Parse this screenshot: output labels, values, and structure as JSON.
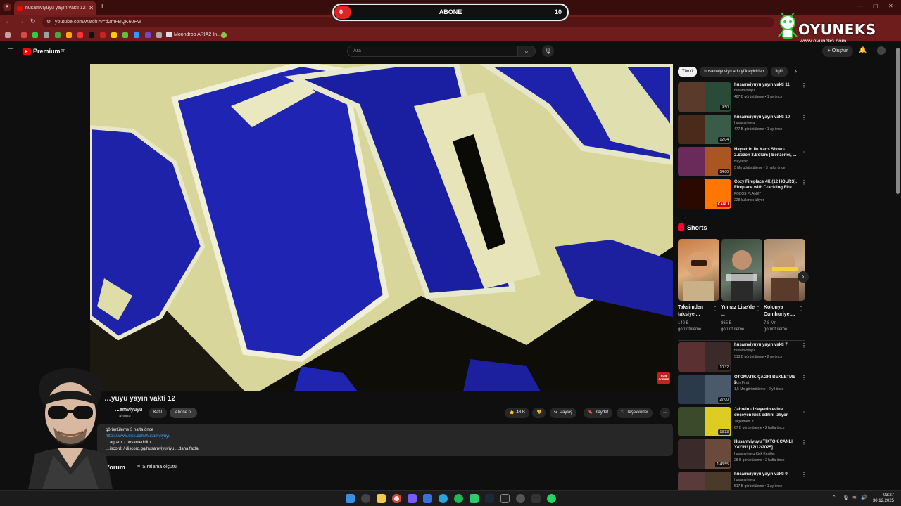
{
  "browser": {
    "tab_title": "husamviyuyu yayın vakti 12 - You",
    "tab_close": "✕",
    "new_tab": "+",
    "url": "youtube.com/watch?v=d2mFBQK60Hw",
    "bookmark_label": "Moondrop ARIA2 In..."
  },
  "overlay": {
    "sub_current": "0",
    "sub_label": "ABONE",
    "sub_goal": "10",
    "sub_progress": 0.0,
    "logo_brand": "OYUNEKS",
    "logo_url": "www.oyuneks.com"
  },
  "youtube": {
    "logo_text": "Premium",
    "logo_sup": "TR",
    "search_placeholder": "Ara",
    "create_label": "Oluştur"
  },
  "video": {
    "title": "…yuyu yayın vakti 12",
    "channel": "…amviyuyu",
    "subs": "…abone",
    "join_label": "Katıl",
    "subscribe_label": "Abone ol",
    "likes": "43 B",
    "share_label": "Paylaş",
    "save_label": "Kaydet",
    "thanks_label": "Teşekkürler",
    "more_label": "···",
    "badge_text": "SUB SCRIBE",
    "desc_line1": "görüntüleme  3 hafta önce",
    "desc_line2": "https://www.kick.com/husamviyuyu",
    "desc_line3": "…agram:   / husamedditnl",
    "desc_line4": "…iscord:   / discord.gg/husamviyuviyu   ...daha fazla",
    "comments_label": "Yorum",
    "sort_label": "Sıralama ölçütü:"
  },
  "chips": [
    "Tümü",
    "husamviyuviyu adlı yükleyiciden",
    "İlgili"
  ],
  "recommendations": [
    {
      "title": "husamviyuyu yayın vakti 11",
      "channel": "husamviyuyu",
      "meta": "487 B görüntüleme • 1 ay önce",
      "duration": "9:50",
      "colors": [
        "#5a3a2a",
        "#2a4a3a"
      ]
    },
    {
      "title": "husamviyuyu yayın vakti 10",
      "channel": "husamviyuyu",
      "meta": "477 B görüntüleme • 1 ay önce",
      "duration": "12:04",
      "colors": [
        "#4a2a1a",
        "#3a5a4a"
      ]
    },
    {
      "title": "Hayrettin ile Kaos Show - 2.Sezon 3.Bölüm | Benzerler, ...",
      "channel": "Hayrettin",
      "meta": "5 Mn görüntüleme • 3 hafta önce",
      "duration": "54:00",
      "colors": [
        "#6a2a5a",
        "#aa5522"
      ]
    },
    {
      "title": "Cozy Fireplace 4K (12 HOURS). Fireplace with Crackling Fire ...",
      "channel": "FOBOS PLANET",
      "meta": "228 kullanıcı izliyor",
      "duration": "CANLI",
      "colors": [
        "#2a0a00",
        "#ff7700"
      ]
    }
  ],
  "shorts": {
    "heading": "Shorts",
    "items": [
      {
        "title": "Taksimden taksiye ...",
        "views": "140 B görüntüleme"
      },
      {
        "title": "Yılmaz Lise'de ...",
        "views": "865 B görüntüleme"
      },
      {
        "title": "Kolonya Cumhuriyet...",
        "views": "7,8 Mn görüntüleme"
      }
    ]
  },
  "recommendations2": [
    {
      "title": "husamviyuyu yayın vakti 7",
      "channel": "husamviyuyu",
      "meta": "513 B görüntüleme • 2 ay önce",
      "duration": "10:32",
      "colors": [
        "#5a3030",
        "#3a2a2a"
      ]
    },
    {
      "title": "OTOMATİK ÇAĞRI BEKLETME 2",
      "channel": "İlker Fırat",
      "meta": "1,5 Mn görüntüleme • 2 yıl önce",
      "duration": "27:00",
      "colors": [
        "#2a3a4a",
        "#4a5a6a"
      ]
    },
    {
      "title": "Jahrein - İzleyenin evine döşeyen kick editini izliyor",
      "channel": "Jagermeh Jr.",
      "meta": "67 B görüntüleme • 2 hafta önce",
      "duration": "13:33",
      "colors": [
        "#3a4a2a",
        "#ddcc22"
      ]
    },
    {
      "title": "Husamviyuyu TİKTOK CANLI YAYIN! [12/12/2025]",
      "channel": "husamviyuyu Kick Kesitler",
      "meta": "28 B görüntüleme • 2 hafta önce",
      "duration": "1:43:55",
      "colors": [
        "#3a2a2a",
        "#6a4a3a"
      ]
    },
    {
      "title": "husamviyuyu yayın vakti 9",
      "channel": "husamviyuyu",
      "meta": "517 B görüntüleme • 1 ay önce",
      "duration": "",
      "colors": [
        "#5a3a3a",
        "#4a3a2a"
      ]
    }
  ],
  "clock": {
    "time": "03:27",
    "date": "30.12.2025"
  }
}
